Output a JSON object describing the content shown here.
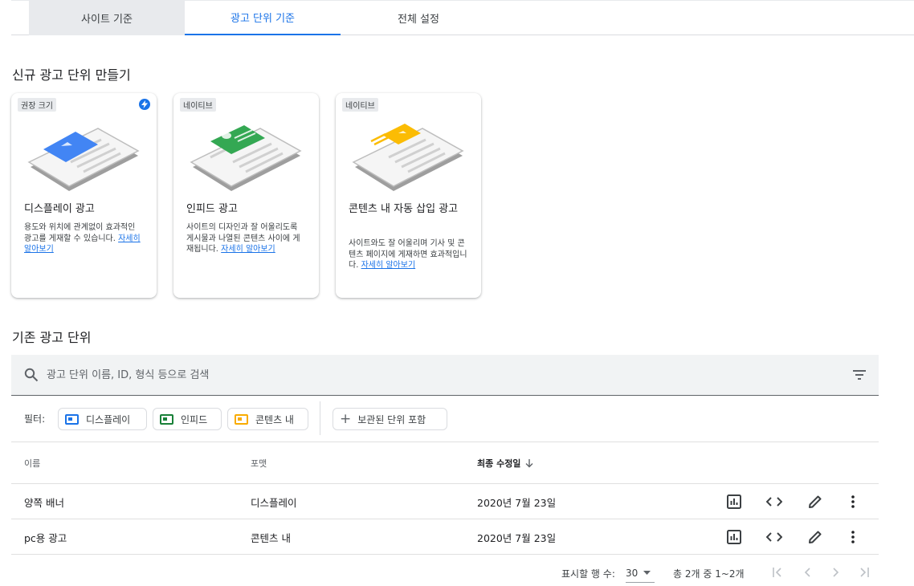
{
  "tabs": [
    {
      "label": "사이트 기준"
    },
    {
      "label": "광고 단위 기준"
    },
    {
      "label": "전체 설정"
    }
  ],
  "new_section": {
    "title": "신규 광고 단위 만들기",
    "cards": [
      {
        "chip": "권장 크기",
        "title": "디스플레이 광고",
        "desc": "용도와 위치에 관계없이 효과적인 광고를 게재할 수 있습니다. ",
        "link": "자세히 알아보기",
        "accent": "#4285f4"
      },
      {
        "chip": "네이티브",
        "title": "인피드 광고",
        "desc": "사이트의 디자인과 잘 어울리도록 게시물과 나열된 콘텐츠 사이에 게재됩니다. ",
        "link": "자세히 알아보기",
        "accent": "#34a853"
      },
      {
        "chip": "네이티브",
        "title": "콘텐츠 내 자동 삽입 광고",
        "desc": "사이트와도 잘 어울리며 기사 및 콘텐츠 페이지에 게재하면 효과적입니다. ",
        "link": "자세히 알아보기",
        "accent": "#fbbc04"
      }
    ]
  },
  "existing_section": {
    "title": "기존 광고 단위",
    "search_placeholder": "광고 단위 이름, ID, 형식 등으로 검색",
    "filter_label": "필터:",
    "filters": [
      {
        "label": "디스플레이",
        "color": "#1a73e8"
      },
      {
        "label": "인피드",
        "color": "#188038"
      },
      {
        "label": "콘텐츠 내",
        "color": "#f9ab00"
      }
    ],
    "archived_label": "보관된 단위 포함",
    "columns": {
      "name": "이름",
      "format": "포맷",
      "modified": "최종 수정일"
    },
    "rows": [
      {
        "name": "양쪽 배너",
        "format": "디스플레이",
        "modified": "2020년 7월 23일"
      },
      {
        "name": "pc용 광고",
        "format": "콘텐츠 내",
        "modified": "2020년 7월 23일"
      }
    ],
    "row_actions": [
      "bar-chart-icon",
      "code-icon",
      "edit-pencil-icon",
      "more-vert-icon"
    ]
  },
  "pagination": {
    "rows_per_page_label": "표시할 행 수:",
    "rows_per_page": "30",
    "range": "총 2개 중 1~2개"
  }
}
